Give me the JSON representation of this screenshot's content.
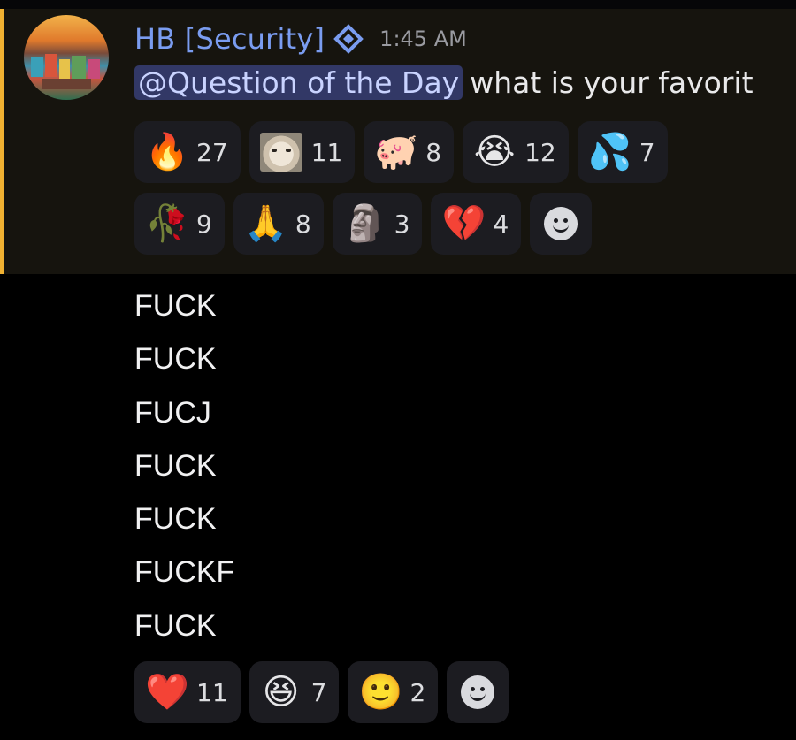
{
  "message": {
    "author": "HB [Security]",
    "timestamp": "1:45 AM",
    "mention": "@Question of the Day",
    "text": "what is your favorit"
  },
  "reactions_top_row1": [
    {
      "icon": "fire-emoji",
      "glyph": "🔥",
      "count": "27"
    },
    {
      "icon": "cat-image-emoji",
      "glyph": "",
      "count": "11"
    },
    {
      "icon": "pig-emoji",
      "glyph": "🐖",
      "count": "8"
    },
    {
      "icon": "crying-face-emoji",
      "glyph": "😭",
      "count": "12"
    },
    {
      "icon": "sweat-droplets-emoji",
      "glyph": "💦",
      "count": "7"
    }
  ],
  "reactions_top_row2": [
    {
      "icon": "wilted-flower-emoji",
      "glyph": "🥀",
      "count": "9"
    },
    {
      "icon": "folded-hands-emoji",
      "glyph": "🙏",
      "count": "8"
    },
    {
      "icon": "moai-emoji",
      "glyph": "🗿",
      "count": "3"
    },
    {
      "icon": "broken-heart-emoji",
      "glyph": "💔",
      "count": "4"
    }
  ],
  "lines": [
    "FUCK",
    "FUCK",
    "FUCJ",
    "FUCK",
    "FUCK",
    "FUCKF",
    "FUCK"
  ],
  "reactions_bottom": [
    {
      "icon": "red-heart-emoji",
      "glyph": "❤️",
      "count": "11"
    },
    {
      "icon": "laughing-face-emoji",
      "glyph": "😆",
      "count": "7"
    },
    {
      "icon": "slightly-smiling-face-emoji",
      "glyph": "🙂",
      "count": "2"
    }
  ],
  "colors": {
    "author": "#7a9cf0",
    "mention_bg": "#323866",
    "mention_bar": "#f0b132",
    "reaction_bg": "#1c1c21"
  }
}
